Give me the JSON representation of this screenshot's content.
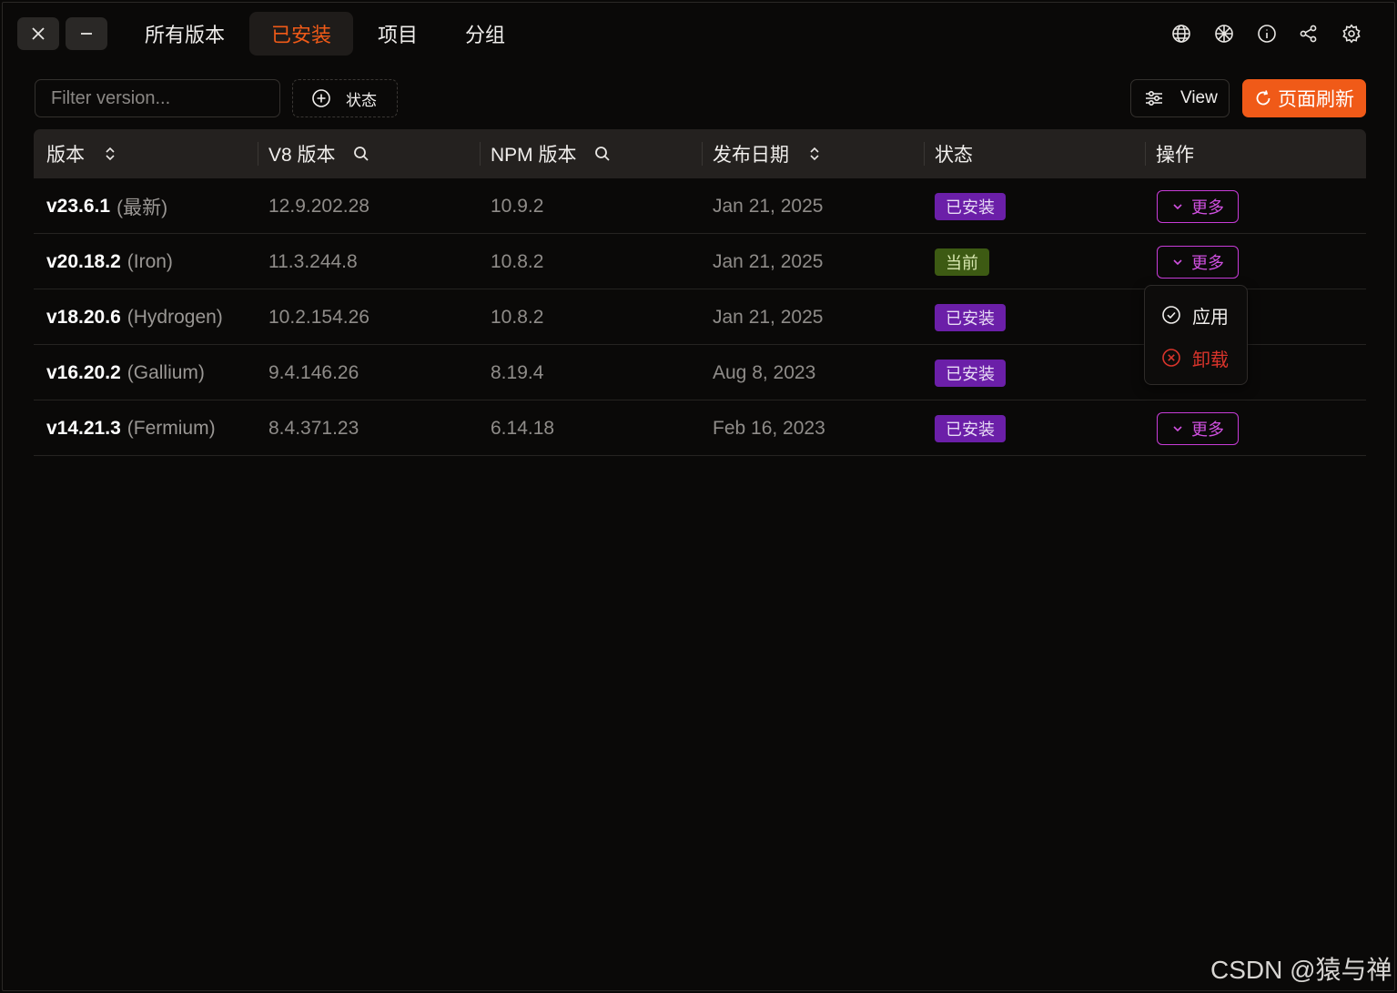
{
  "window_controls": {
    "close": "close",
    "minimize": "minimize"
  },
  "tabs": [
    {
      "label": "所有版本",
      "active": false
    },
    {
      "label": "已安装",
      "active": true
    },
    {
      "label": "项目",
      "active": false
    },
    {
      "label": "分组",
      "active": false
    }
  ],
  "top_icons": [
    "globe-icon",
    "snowflake-icon",
    "info-icon",
    "share-icon",
    "settings-icon"
  ],
  "toolbar": {
    "filter_placeholder": "Filter version...",
    "status_filter_label": "状态",
    "view_label": "View",
    "refresh_label": "页面刷新"
  },
  "table": {
    "columns": [
      "版本",
      "V8 版本",
      "NPM 版本",
      "发布日期",
      "状态",
      "操作"
    ],
    "rows": [
      {
        "version": "v23.6.1",
        "codename": "(最新)",
        "v8": "12.9.202.28",
        "npm": "10.9.2",
        "date": "Jan 21, 2025",
        "status": "已安装",
        "status_type": "installed",
        "action": "更多"
      },
      {
        "version": "v20.18.2",
        "codename": "(Iron)",
        "v8": "11.3.244.8",
        "npm": "10.8.2",
        "date": "Jan 21, 2025",
        "status": "当前",
        "status_type": "current",
        "action": "更多"
      },
      {
        "version": "v18.20.6",
        "codename": "(Hydrogen)",
        "v8": "10.2.154.26",
        "npm": "10.8.2",
        "date": "Jan 21, 2025",
        "status": "已安装",
        "status_type": "installed",
        "action": ""
      },
      {
        "version": "v16.20.2",
        "codename": "(Gallium)",
        "v8": "9.4.146.26",
        "npm": "8.19.4",
        "date": "Aug 8, 2023",
        "status": "已安装",
        "status_type": "installed",
        "action": ""
      },
      {
        "version": "v14.21.3",
        "codename": "(Fermium)",
        "v8": "8.4.371.23",
        "npm": "6.14.18",
        "date": "Feb 16, 2023",
        "status": "已安装",
        "status_type": "installed",
        "action": "更多"
      }
    ]
  },
  "dropdown": {
    "apply": "应用",
    "uninstall": "卸载"
  },
  "watermark": "CSDN @猿与禅",
  "colors": {
    "accent": "#f05a18",
    "installed": "#6b1fa8",
    "current": "#3d5a13",
    "more_border": "#c83cd8",
    "danger": "#d9342b"
  }
}
